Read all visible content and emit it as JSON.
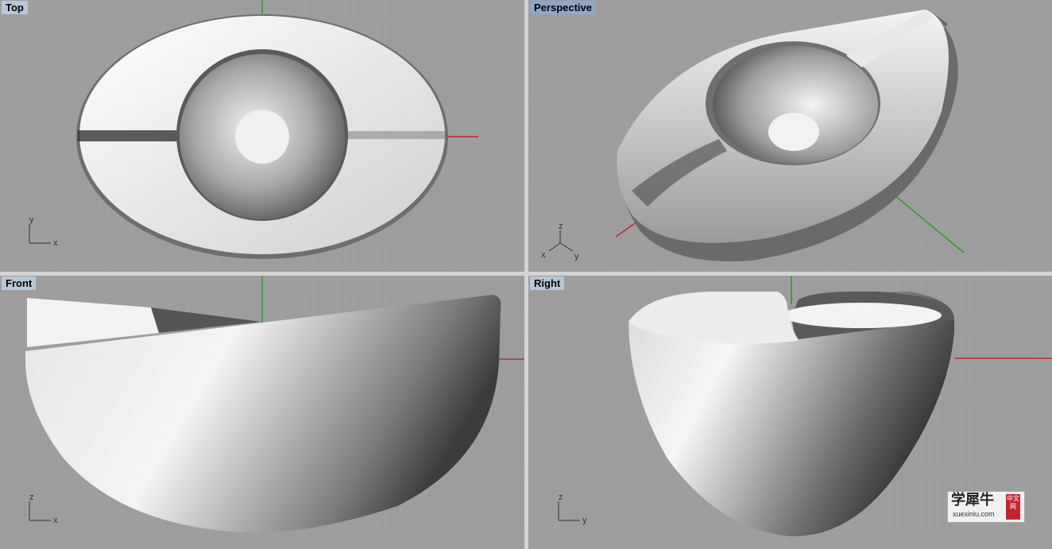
{
  "viewports": [
    {
      "id": "top",
      "title": "Top",
      "axis_labels": [
        "y",
        "x"
      ]
    },
    {
      "id": "perspective",
      "title": "Perspective",
      "axis_labels": [
        "z",
        "x",
        "y"
      ]
    },
    {
      "id": "front",
      "title": "Front",
      "axis_labels": [
        "z",
        "x"
      ]
    },
    {
      "id": "right",
      "title": "Right",
      "axis_labels": [
        "z",
        "y"
      ]
    }
  ],
  "watermark": {
    "main": "学犀牛",
    "sub": "xuexiniu.com",
    "badge": "中文网"
  },
  "colors": {
    "viewport_bg": "#9e9e9e",
    "grid": "#8f8f8f",
    "axis_x": "#c0282a",
    "axis_y": "#2a9a2a",
    "title_bg": "#b9c7d8"
  }
}
